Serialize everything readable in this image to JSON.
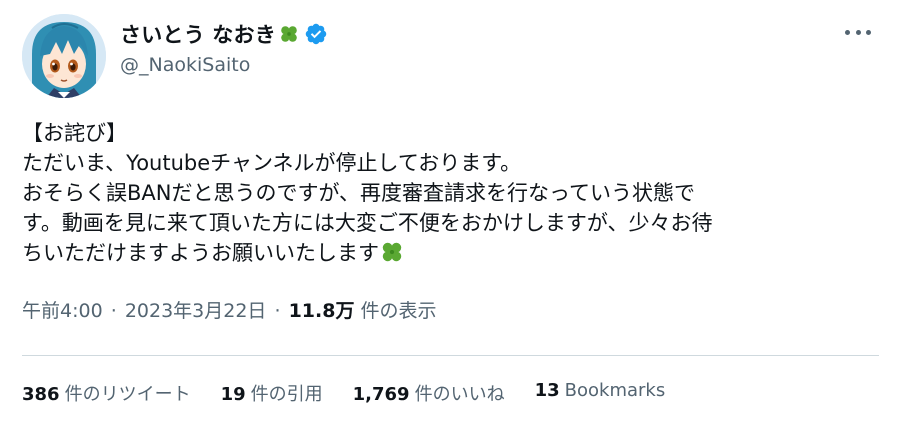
{
  "author": {
    "display_name": "さいとう なおき",
    "handle": "@_NaokiSaito",
    "name_emoji": "four-leaf-clover",
    "verified_icon": "verified-badge-icon",
    "verified_color": "#1d9bf0"
  },
  "tweet": {
    "lines": [
      "【お詫び】",
      "ただいま、Youtubeチャンネルが停止しております。",
      "おそらく誤BANだと思うのですが、再度審査請求を行なっていう状態で",
      "す。動画を見に来て頂いた方には大変ご不便をおかけしますが、少々お待",
      "ちいただけますようお願いいたします"
    ],
    "trailing_emoji": "four-leaf-clover"
  },
  "meta": {
    "time": "午前4:00",
    "separator": "·",
    "date": "2023年3月22日",
    "views_count": "11.8万",
    "views_label": "件の表示"
  },
  "stats": {
    "retweets": {
      "count": "386",
      "label": "件のリツイート"
    },
    "quotes": {
      "count": "19",
      "label": "件の引用"
    },
    "likes": {
      "count": "1,769",
      "label": "件のいいね"
    },
    "bookmarks": {
      "count": "13",
      "label": "Bookmarks"
    }
  },
  "colors": {
    "text": "#0f1419",
    "secondary": "#536471",
    "divider": "#cfd9de",
    "clover": "#5aa832"
  }
}
